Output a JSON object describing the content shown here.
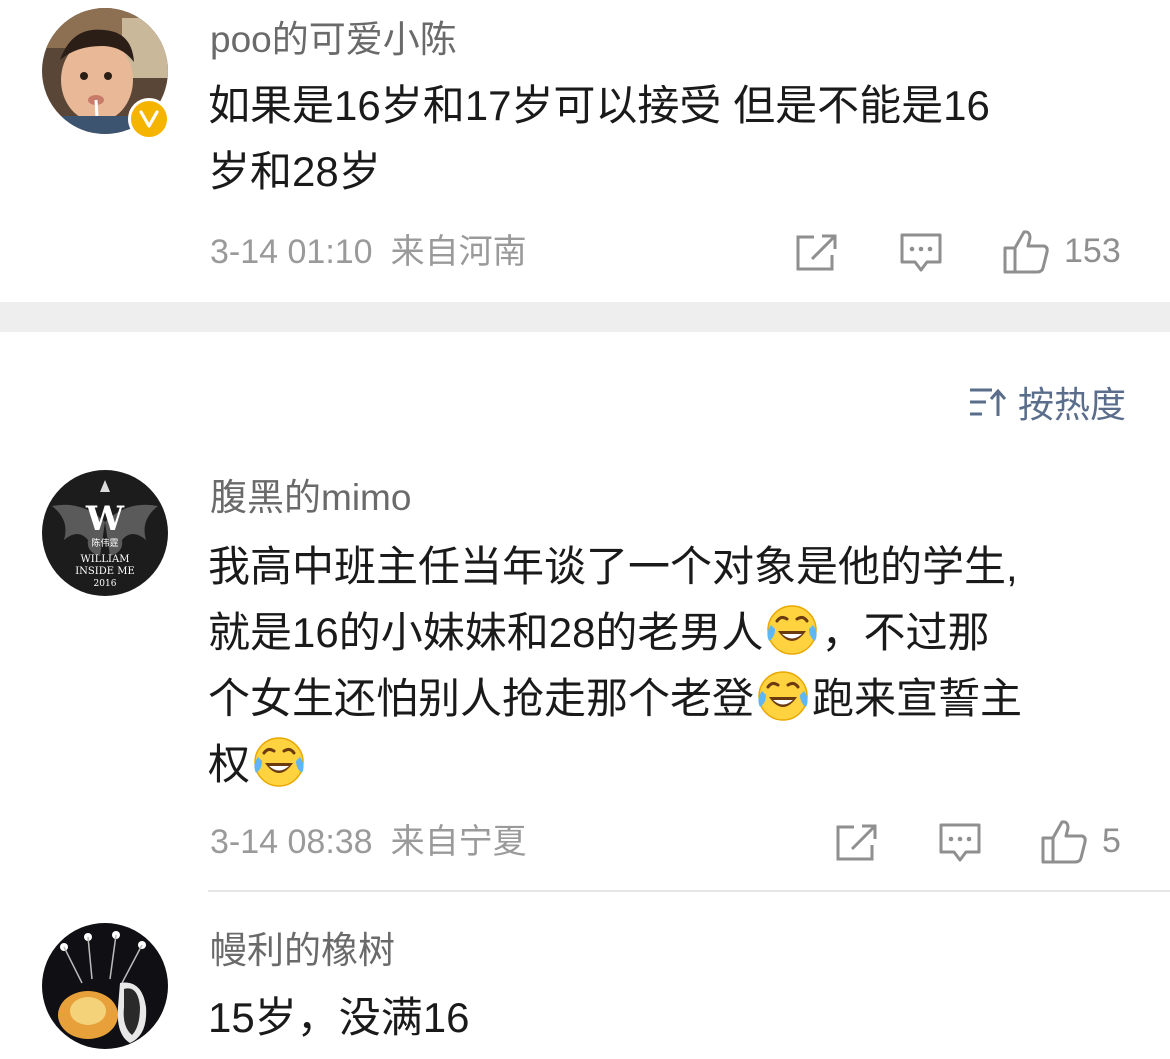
{
  "comments": [
    {
      "username": "poo的可爱小陈",
      "verified": true,
      "lines": [
        "如果是16岁和17岁可以接受 但是不能是16",
        "岁和28岁"
      ],
      "date": "3-14 01:10",
      "location": "来自河南",
      "like_count": "153"
    },
    {
      "username": "腹黑的mimo",
      "avatar_text": [
        "W",
        "陈伟霆",
        "WILLIAM",
        "INSIDE ME",
        "2016"
      ],
      "lines": [
        {
          "parts": [
            "我高中班主任当年谈了一个对象是他的学生,"
          ]
        },
        {
          "parts": [
            "就是16的小妹妹和28的老男人",
            "，不过那"
          ]
        },
        {
          "parts": [
            "个女生还怕别人抢走那个老登",
            "跑来宣誓主"
          ]
        },
        {
          "parts": [
            "权",
            ""
          ]
        }
      ],
      "date": "3-14 08:38",
      "location": "来自宁夏",
      "like_count": "5"
    },
    {
      "username": "幔利的橡树",
      "lines": [
        "15岁，没满16"
      ]
    }
  ],
  "sort": {
    "label": "按热度",
    "icon": "sort-icon"
  },
  "icons": {
    "share": "share-icon",
    "comment": "comment-icon",
    "like": "thumbs-up-icon",
    "emoji": "laugh-cry-emoji",
    "verified": "verified-badge-icon"
  },
  "colors": {
    "accent": "#5a6e8c",
    "verified": "#f5b400",
    "meta": "#9a9a9a",
    "separator": "#eeeeee"
  }
}
